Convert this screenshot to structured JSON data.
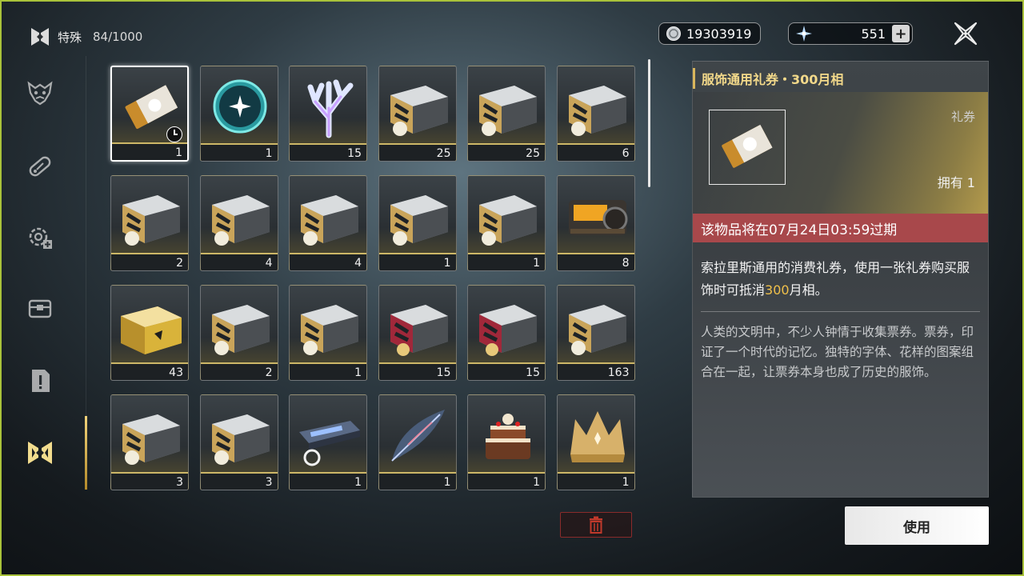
{
  "header": {
    "category_label": "特殊",
    "capacity": "84/1000",
    "icon": "special-category-icon"
  },
  "sidebar": {
    "items": [
      {
        "icon": "demon-mask-icon",
        "active": false
      },
      {
        "icon": "pill-capsule-icon",
        "active": false
      },
      {
        "icon": "gear-plus-icon",
        "active": false
      },
      {
        "icon": "chest-box-icon",
        "active": false
      },
      {
        "icon": "quest-document-icon",
        "active": false
      },
      {
        "icon": "special-category-icon",
        "active": true
      }
    ]
  },
  "currency": {
    "coins": {
      "icon": "coin-icon",
      "value": "19303919"
    },
    "crystals": {
      "icon": "star-crystal-icon",
      "value": "551",
      "add_label": "+"
    }
  },
  "items": [
    {
      "art": "ticket-voucher",
      "qty": "1",
      "selected": true,
      "timer": true
    },
    {
      "art": "crystal-orb",
      "qty": "1"
    },
    {
      "art": "coral",
      "qty": "15"
    },
    {
      "art": "silver-chest-gold",
      "qty": "25"
    },
    {
      "art": "silver-chest-gold",
      "qty": "25"
    },
    {
      "art": "silver-chest-gold",
      "qty": "6"
    },
    {
      "art": "silver-chest-gold",
      "qty": "2"
    },
    {
      "art": "silver-chest-gold",
      "qty": "4"
    },
    {
      "art": "silver-chest-gold",
      "qty": "4"
    },
    {
      "art": "silver-chest-gold",
      "qty": "1"
    },
    {
      "art": "silver-chest-gold",
      "qty": "1"
    },
    {
      "art": "dark-chest-orange",
      "qty": "8"
    },
    {
      "art": "gold-chest",
      "qty": "43"
    },
    {
      "art": "silver-chest-gold",
      "qty": "2"
    },
    {
      "art": "silver-chest-gold",
      "qty": "1"
    },
    {
      "art": "red-chest",
      "qty": "15"
    },
    {
      "art": "red-chest",
      "qty": "15"
    },
    {
      "art": "silver-chest-gold",
      "qty": "163"
    },
    {
      "art": "silver-chest-gold",
      "qty": "3"
    },
    {
      "art": "silver-chest-gold",
      "qty": "3"
    },
    {
      "art": "weapon-case",
      "qty": "1"
    },
    {
      "art": "feather-leaf",
      "qty": "1"
    },
    {
      "art": "cake",
      "qty": "1"
    },
    {
      "art": "gold-crown",
      "qty": "1"
    }
  ],
  "detail": {
    "title": "服饰通用礼券・300月相",
    "type": "礼券",
    "owned": "拥有 1",
    "expire": "该物品将在07月24日03:59过期",
    "desc_prefix": "索拉里斯通用的消费礼券，使用一张礼券购买服饰时可抵消",
    "desc_highlight": "300",
    "desc_suffix": "月相。",
    "lore": "人类的文明中，不少人钟情于收集票券。票券，印证了一个时代的记忆。独特的字体、花样的图案组合在一起，让票券本身也成了历史的服饰。"
  },
  "buttons": {
    "use_label": "使用",
    "delete_icon": "trash-icon",
    "close_icon": "close-star-icon"
  },
  "colors": {
    "accent_gold": "#d9b65c",
    "highlight": "#f0c04a",
    "expire_bg": "#a8484b",
    "delete_border": "#8a2b2b"
  }
}
